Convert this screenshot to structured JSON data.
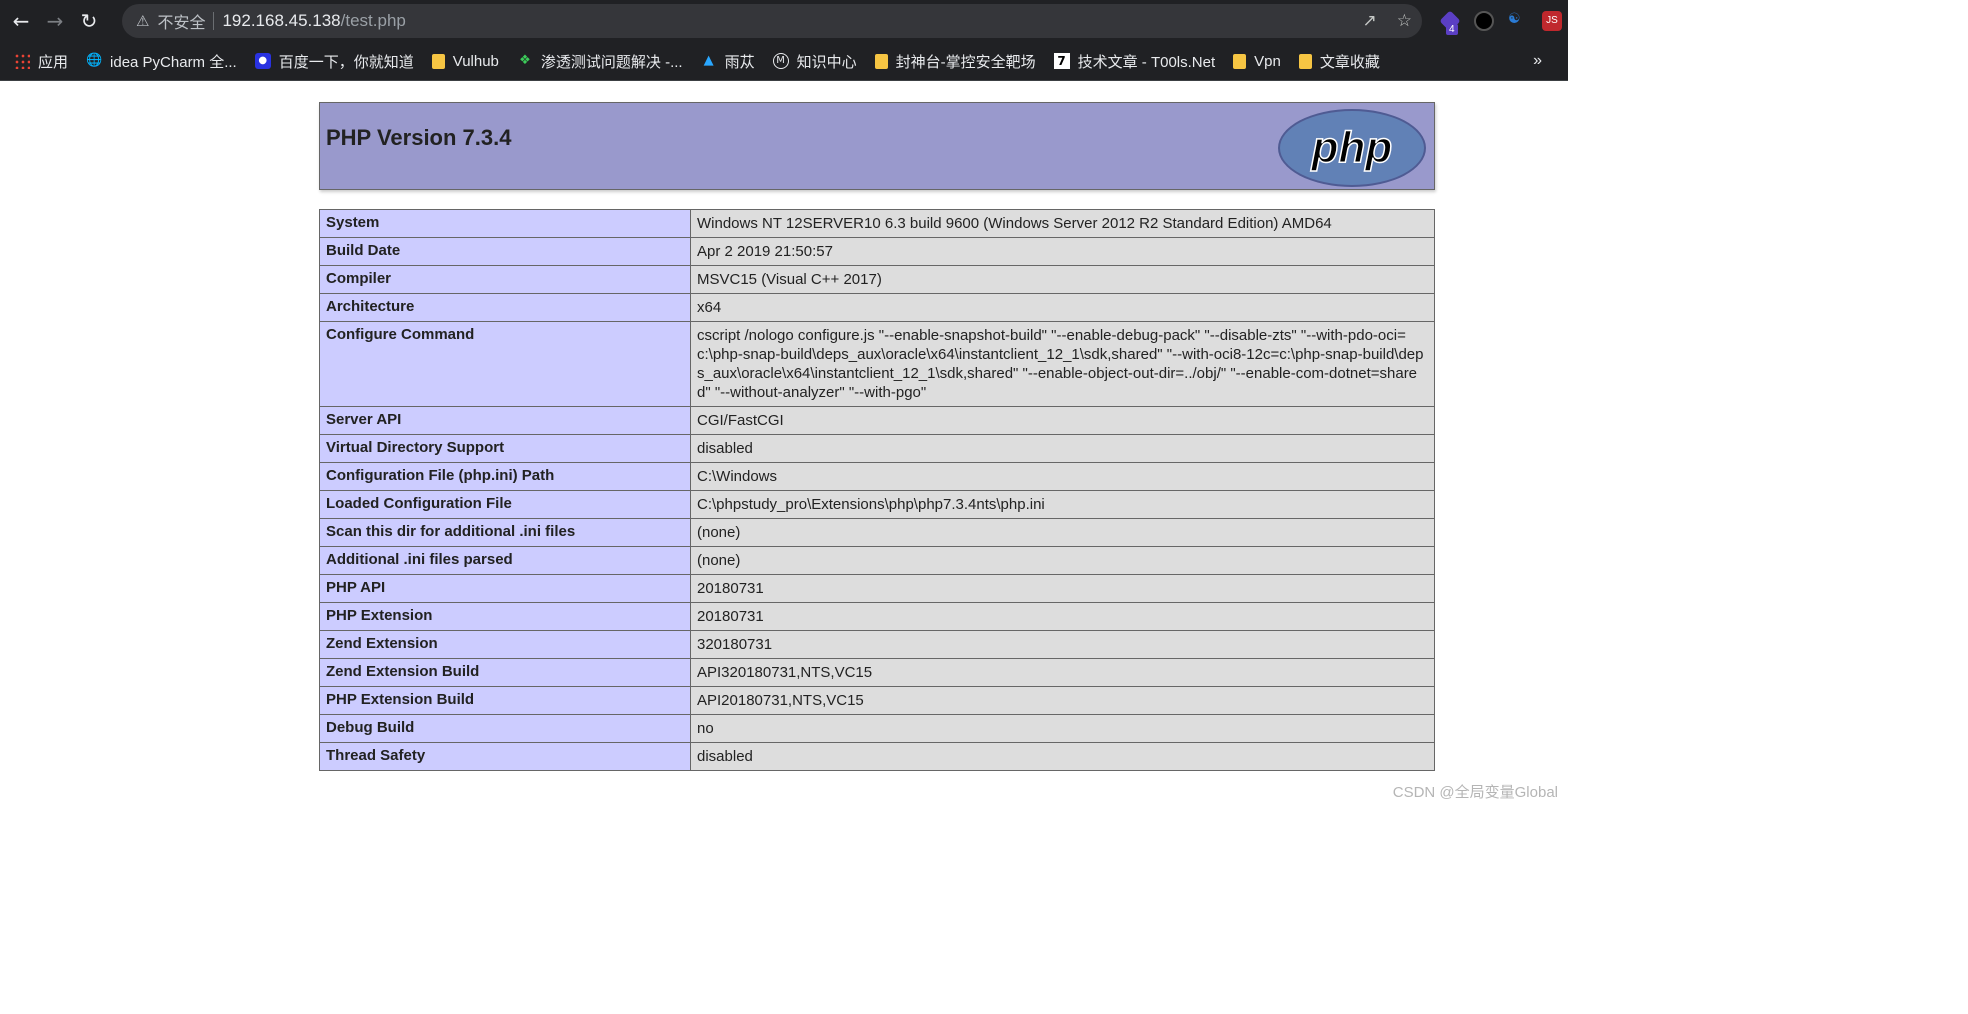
{
  "browser": {
    "insecure_label": "不安全",
    "url_host": "192.168.45.138",
    "url_path": "/test.php",
    "extension_badge": "4",
    "extension_js": "JS"
  },
  "bookmarks": [
    {
      "label": "应用",
      "icon": "apps-icon"
    },
    {
      "label": "idea PyCharm 全...",
      "icon": "globe-icon"
    },
    {
      "label": "百度一下，你就知道",
      "icon": "baidu-icon"
    },
    {
      "label": "Vulhub",
      "icon": "folder-icon"
    },
    {
      "label": "渗透测试问题解决 -...",
      "icon": "leaf-icon"
    },
    {
      "label": "雨苁",
      "icon": "arrow-icon"
    },
    {
      "label": "知识中心",
      "icon": "m-circle-icon"
    },
    {
      "label": "封神台-掌控安全靶场",
      "icon": "folder-icon"
    },
    {
      "label": "技术文章 - T00ls.Net",
      "icon": "seven-icon"
    },
    {
      "label": "Vpn",
      "icon": "folder-icon"
    },
    {
      "label": "文章收藏",
      "icon": "folder-icon"
    }
  ],
  "php": {
    "title": "PHP Version 7.3.4",
    "logo_text": "php",
    "rows": [
      {
        "k": "System",
        "v": "Windows NT 12SERVER10 6.3 build 9600 (Windows Server 2012 R2 Standard Edition) AMD64"
      },
      {
        "k": "Build Date",
        "v": "Apr 2 2019 21:50:57"
      },
      {
        "k": "Compiler",
        "v": "MSVC15 (Visual C++ 2017)"
      },
      {
        "k": "Architecture",
        "v": "x64"
      },
      {
        "k": "Configure Command",
        "v": "cscript /nologo configure.js \"--enable-snapshot-build\" \"--enable-debug-pack\" \"--disable-zts\" \"--with-pdo-oci=c:\\php-snap-build\\deps_aux\\oracle\\x64\\instantclient_12_1\\sdk,shared\" \"--with-oci8-12c=c:\\php-snap-build\\deps_aux\\oracle\\x64\\instantclient_12_1\\sdk,shared\" \"--enable-object-out-dir=../obj/\" \"--enable-com-dotnet=shared\" \"--without-analyzer\" \"--with-pgo\""
      },
      {
        "k": "Server API",
        "v": "CGI/FastCGI"
      },
      {
        "k": "Virtual Directory Support",
        "v": "disabled"
      },
      {
        "k": "Configuration File (php.ini) Path",
        "v": "C:\\Windows"
      },
      {
        "k": "Loaded Configuration File",
        "v": "C:\\phpstudy_pro\\Extensions\\php\\php7.3.4nts\\php.ini"
      },
      {
        "k": "Scan this dir for additional .ini files",
        "v": "(none)"
      },
      {
        "k": "Additional .ini files parsed",
        "v": "(none)"
      },
      {
        "k": "PHP API",
        "v": "20180731"
      },
      {
        "k": "PHP Extension",
        "v": "20180731"
      },
      {
        "k": "Zend Extension",
        "v": "320180731"
      },
      {
        "k": "Zend Extension Build",
        "v": "API320180731,NTS,VC15"
      },
      {
        "k": "PHP Extension Build",
        "v": "API20180731,NTS,VC15"
      },
      {
        "k": "Debug Build",
        "v": "no"
      },
      {
        "k": "Thread Safety",
        "v": "disabled"
      }
    ]
  },
  "watermark": "CSDN @全局变量Global"
}
